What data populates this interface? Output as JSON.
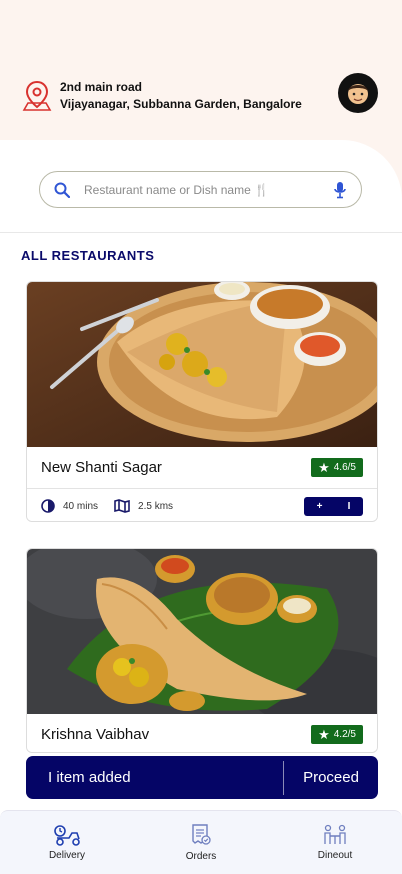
{
  "location": {
    "line1": "2nd main road",
    "line2": "Vijayanagar, Subbanna Garden, Bangalore"
  },
  "search": {
    "placeholder": "Restaurant name or Dish name 🍴"
  },
  "section_title": "ALL RESTAURANTS",
  "restaurants": [
    {
      "name": "New Shanti Sagar",
      "rating": "4.6/5",
      "time": "40 mins",
      "distance": "2.5 kms",
      "stepper_minus": "+",
      "stepper_count": "I"
    },
    {
      "name": "Krishna Vaibhav",
      "rating": "4.2/5"
    }
  ],
  "cart": {
    "count_label": "I item added",
    "proceed_label": "Proceed"
  },
  "nav": [
    {
      "label": "Delivery",
      "icon": "delivery-scooter-icon"
    },
    {
      "label": "Orders",
      "icon": "orders-receipt-icon"
    },
    {
      "label": "Dineout",
      "icon": "dineout-table-icon"
    }
  ],
  "colors": {
    "primary": "#050566",
    "accent": "#d8322f",
    "rating_green": "#126b1c",
    "header_bg": "#fdf4ef",
    "nav_bg": "#f4f6fc"
  }
}
